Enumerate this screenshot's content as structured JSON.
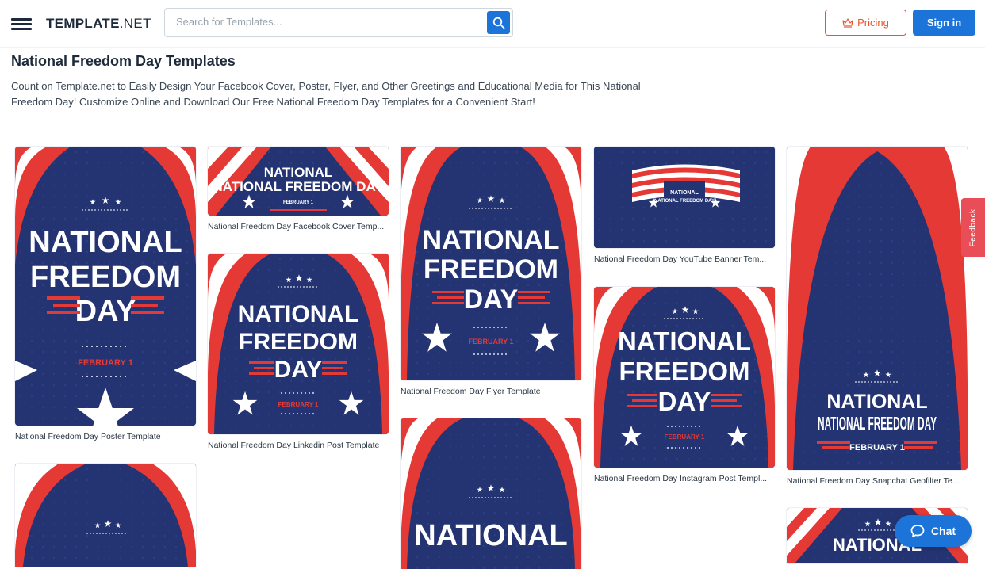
{
  "header": {
    "logo_bold": "TEMPLATE",
    "logo_light": ".NET",
    "search_placeholder": "Search for Templates...",
    "pricing_label": "Pricing",
    "signin_label": "Sign in"
  },
  "page": {
    "title": "National Freedom Day Templates",
    "description": "Count on Template.net to Easily Design Your Facebook Cover, Poster, Flyer, and Other Greetings and Educational Media for This National Freedom Day! Customize Online and Download Our Free National Freedom Day Templates for a Convenient Start!"
  },
  "thumb_text": {
    "line1": "NATIONAL",
    "line2": "FREEDOM",
    "line3": "DAY",
    "one_line": "NATIONAL FREEDOM DAY",
    "date": "FEBRUARY 1"
  },
  "cards": [
    {
      "caption": "National Freedom Day Poster Template"
    },
    {
      "caption": "National Freedom Day Facebook Cover Temp..."
    },
    {
      "caption": "National Freedom Day Linkedin Post Template"
    },
    {
      "caption": "National Freedom Day Flyer Template"
    },
    {
      "caption": "National Freedom Day YouTube Banner Tem..."
    },
    {
      "caption": "National Freedom Day Instagram Post Templ..."
    },
    {
      "caption": "National Freedom Day Snapchat Geofilter Te..."
    }
  ],
  "widgets": {
    "feedback_label": "Feedback",
    "chat_label": "Chat"
  },
  "colors": {
    "navy": "#243472",
    "red": "#e53935",
    "accent_blue": "#1c74d9",
    "pricing_orange": "#e8542b",
    "feedback_red": "#e94d58"
  }
}
